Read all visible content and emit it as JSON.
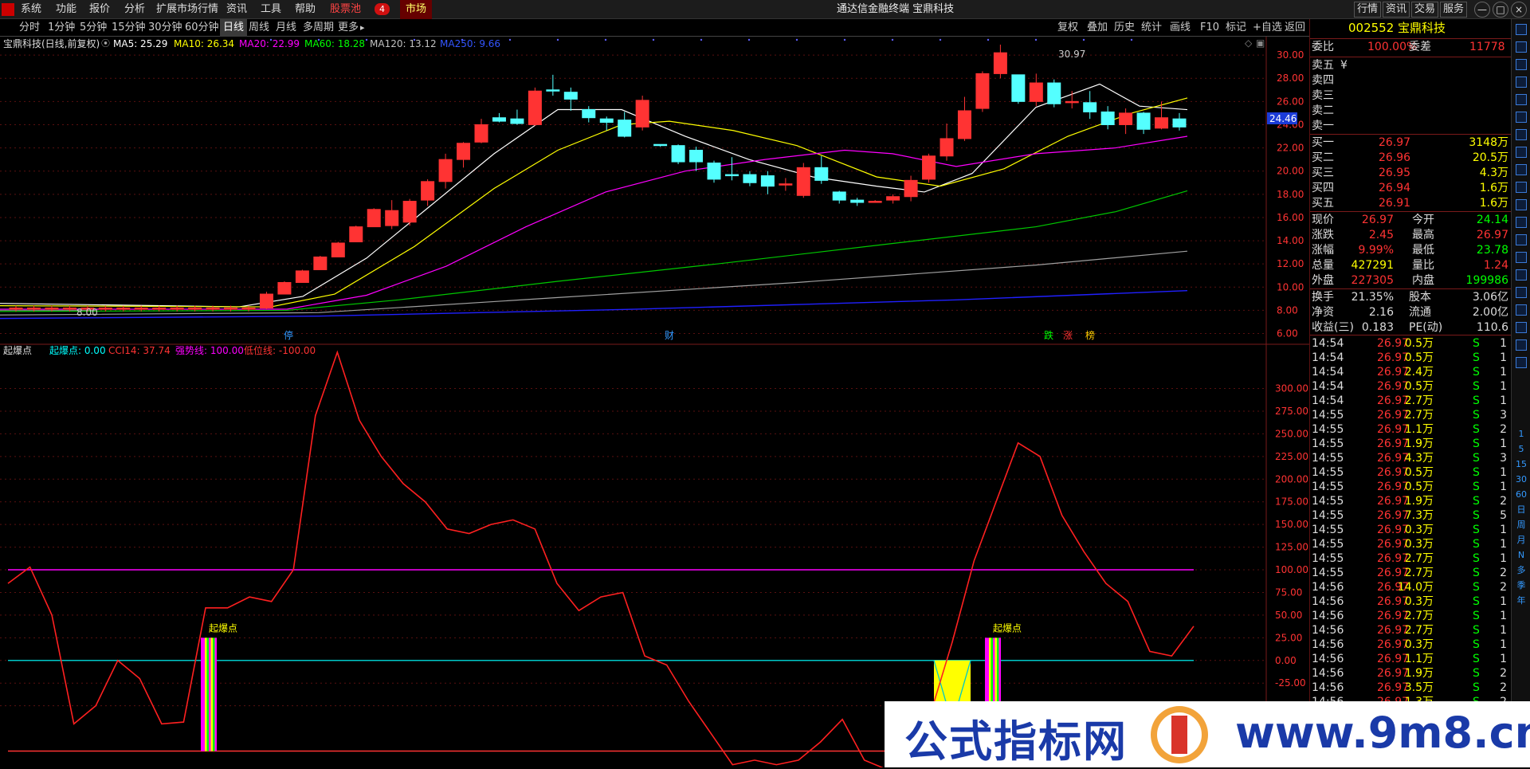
{
  "menubar": {
    "items": [
      "系统",
      "功能",
      "报价",
      "分析",
      "扩展市场行情",
      "资讯",
      "工具",
      "帮助",
      "股票池",
      "4",
      "市场"
    ],
    "window_title": "通达信金融终端  宝鼎科技"
  },
  "winbuttons": [
    "行情",
    "资讯",
    "交易",
    "服务",
    "—",
    "□",
    "×"
  ],
  "periods": [
    "分时",
    "1分钟",
    "5分钟",
    "15分钟",
    "30分钟",
    "60分钟",
    "日线",
    "周线",
    "月线",
    "多周期",
    "更多"
  ],
  "active_period": "日线",
  "toolbar": [
    "复权",
    "叠加",
    "历史",
    "统计",
    "画线",
    "F10",
    "标记",
    "+自选",
    "返回"
  ],
  "main_header": {
    "name": "宝鼎科技(日线,前复权)",
    "ma": [
      {
        "label": "MA5: 25.29",
        "color": "#ffffff"
      },
      {
        "label": "MA10: 26.34",
        "color": "#ffff00"
      },
      {
        "label": "MA20: 22.99",
        "color": "#ff00ff"
      },
      {
        "label": "MA60: 18.28",
        "color": "#00ff00"
      },
      {
        "label": "MA120: 13.12",
        "color": "#c0c0c0"
      },
      {
        "label": "MA250: 9.66",
        "color": "#0000ff"
      }
    ]
  },
  "high_label": "30.97",
  "low_label": "8.00",
  "price_tag": "24.46",
  "price_axis": [
    "30.00",
    "28.00",
    "26.00",
    "24.00",
    "22.00",
    "20.00",
    "18.00",
    "16.00",
    "14.00",
    "12.00",
    "10.00",
    "8.00",
    "6.00"
  ],
  "event_marks": [
    {
      "t": "停",
      "c": "#3399ff"
    },
    {
      "t": "财",
      "c": "#3399ff"
    },
    {
      "t": "跌",
      "c": "#00ff00"
    },
    {
      "t": "涨",
      "c": "#ff3333"
    },
    {
      "t": "榜",
      "c": "#ffcc00"
    }
  ],
  "indicator_header": {
    "name": "起爆点",
    "items": [
      {
        "label": "起爆点: 0.00",
        "color": "#00ffff"
      },
      {
        "label": "CCI14: 37.74",
        "color": "#ff3333"
      },
      {
        "label": "强势线: 100.00",
        "color": "#ff00ff"
      },
      {
        "label": "低位线: -100.00",
        "color": "#ff3333"
      }
    ]
  },
  "signal_label": "起爆点",
  "cci_axis": [
    "300.00",
    "275.00",
    "250.00",
    "225.00",
    "200.00",
    "175.00",
    "150.00",
    "125.00",
    "100.00",
    "75.00",
    "50.00",
    "25.00",
    "0.00",
    "-25.00",
    "-50.00"
  ],
  "chart_data": [
    {
      "type": "candlestick",
      "title": "宝鼎科技(日线,前复权)",
      "ylim": [
        6,
        31
      ],
      "candles": [
        [
          24.6,
          24.3,
          25.0,
          24.2
        ],
        [
          24.5,
          24.1,
          25.3,
          24.0
        ],
        [
          24.0,
          26.9,
          27.2,
          23.9
        ],
        [
          27.0,
          26.9,
          28.3,
          26.5
        ],
        [
          26.8,
          26.2,
          27.2,
          25.2
        ],
        [
          25.3,
          24.6,
          25.6,
          24.2
        ],
        [
          24.5,
          24.2,
          24.7,
          23.5
        ],
        [
          24.4,
          23.0,
          25.1,
          22.9
        ],
        [
          23.8,
          26.1,
          26.5,
          23.5
        ],
        [
          26.0,
          27.6,
          28.4,
          25.6
        ],
        [
          27.6,
          25.8,
          27.9,
          25.5
        ],
        [
          25.9,
          26.0,
          26.9,
          25.4
        ],
        [
          25.9,
          25.1,
          26.9,
          24.5
        ],
        [
          25.1,
          24.0,
          25.6,
          23.6
        ],
        [
          24.0,
          25.0,
          25.4,
          23.2
        ],
        [
          25.0,
          23.6,
          25.1,
          23.2
        ],
        [
          23.7,
          24.6,
          26.0,
          23.6
        ],
        [
          24.5,
          23.8,
          25.0,
          23.5
        ]
      ],
      "ma": [
        {
          "name": "MA5",
          "value": 25.29
        },
        {
          "name": "MA10",
          "value": 26.34
        },
        {
          "name": "MA20",
          "value": 22.99
        },
        {
          "name": "MA60",
          "value": 18.28
        },
        {
          "name": "MA120",
          "value": 13.12
        },
        {
          "name": "MA250",
          "value": 9.66
        }
      ]
    },
    {
      "type": "line",
      "title": "起爆点",
      "ylim": [
        -110,
        340
      ],
      "series": [
        {
          "name": "CCI14",
          "values": [
            85,
            103,
            50,
            -70,
            -50,
            0,
            -20,
            -70,
            -68,
            58,
            58,
            70,
            65,
            100,
            270,
            340,
            265,
            225,
            195,
            175,
            145,
            140,
            150,
            155,
            145,
            85,
            55,
            70,
            75,
            5,
            -5,
            -45,
            -80,
            -115,
            -110,
            -115,
            -110,
            -90,
            -65,
            -110,
            -120,
            -90,
            -60,
            20,
            110,
            175,
            240,
            225,
            160,
            120,
            85,
            65,
            10,
            5,
            37.74
          ]
        },
        {
          "name": "强势线",
          "values": [
            100
          ]
        },
        {
          "name": "低位线",
          "values": [
            -100
          ]
        },
        {
          "name": "起爆点",
          "values": [
            0
          ]
        }
      ]
    }
  ],
  "quote": {
    "code": "002552",
    "name": "宝鼎科技",
    "webi_label": "委比",
    "webi": "100.00%",
    "weicha_label": "委差",
    "weicha": "11778",
    "asks": [
      "卖五",
      "卖四",
      "卖三",
      "卖二",
      "卖一"
    ],
    "ask_price5": "¥",
    "bids": [
      {
        "l": "买一",
        "p": "26.97",
        "v": "3148万"
      },
      {
        "l": "买二",
        "p": "26.96",
        "v": "20.5万"
      },
      {
        "l": "买三",
        "p": "26.95",
        "v": "4.3万"
      },
      {
        "l": "买四",
        "p": "26.94",
        "v": "1.6万"
      },
      {
        "l": "买五",
        "p": "26.91",
        "v": "1.6万"
      }
    ],
    "stats": [
      {
        "l1": "现价",
        "v1": "26.97",
        "c1": "#ff3333",
        "l2": "今开",
        "v2": "24.14",
        "c2": "#00ff00"
      },
      {
        "l1": "涨跌",
        "v1": "2.45",
        "c1": "#ff3333",
        "l2": "最高",
        "v2": "26.97",
        "c2": "#ff3333"
      },
      {
        "l1": "涨幅",
        "v1": "9.99%",
        "c1": "#ff3333",
        "l2": "最低",
        "v2": "23.78",
        "c2": "#00ff00"
      },
      {
        "l1": "总量",
        "v1": "427291",
        "c1": "#ffff00",
        "l2": "量比",
        "v2": "1.24",
        "c2": "#ff3333"
      },
      {
        "l1": "外盘",
        "v1": "227305",
        "c1": "#ff3333",
        "l2": "内盘",
        "v2": "199986",
        "c2": "#00ff00"
      }
    ],
    "stats2": [
      {
        "l1": "换手",
        "v1": "21.35%",
        "l2": "股本",
        "v2": "3.06亿"
      },
      {
        "l1": "净资",
        "v1": "2.16",
        "l2": "流通",
        "v2": "2.00亿"
      },
      {
        "l1": "收益(三)",
        "v1": "0.183",
        "l2": "PE(动)",
        "v2": "110.6"
      }
    ],
    "ticks": [
      [
        "14:54",
        "26.97",
        "0.5万",
        "S",
        "1"
      ],
      [
        "14:54",
        "26.97",
        "0.5万",
        "S",
        "1"
      ],
      [
        "14:54",
        "26.97",
        "2.4万",
        "S",
        "1"
      ],
      [
        "14:54",
        "26.97",
        "0.5万",
        "S",
        "1"
      ],
      [
        "14:54",
        "26.97",
        "2.7万",
        "S",
        "1"
      ],
      [
        "14:55",
        "26.97",
        "2.7万",
        "S",
        "3"
      ],
      [
        "14:55",
        "26.97",
        "1.1万",
        "S",
        "2"
      ],
      [
        "14:55",
        "26.97",
        "1.9万",
        "S",
        "1"
      ],
      [
        "14:55",
        "26.97",
        "4.3万",
        "S",
        "3"
      ],
      [
        "14:55",
        "26.97",
        "0.5万",
        "S",
        "1"
      ],
      [
        "14:55",
        "26.97",
        "0.5万",
        "S",
        "1"
      ],
      [
        "14:55",
        "26.97",
        "1.9万",
        "S",
        "2"
      ],
      [
        "14:55",
        "26.97",
        "7.3万",
        "S",
        "5"
      ],
      [
        "14:55",
        "26.97",
        "0.3万",
        "S",
        "1"
      ],
      [
        "14:55",
        "26.97",
        "0.3万",
        "S",
        "1"
      ],
      [
        "14:55",
        "26.97",
        "2.7万",
        "S",
        "1"
      ],
      [
        "14:55",
        "26.97",
        "2.7万",
        "S",
        "2"
      ],
      [
        "14:56",
        "26.97",
        "14.0万",
        "S",
        "2"
      ],
      [
        "14:56",
        "26.97",
        "0.3万",
        "S",
        "1"
      ],
      [
        "14:56",
        "26.97",
        "2.7万",
        "S",
        "1"
      ],
      [
        "14:56",
        "26.97",
        "2.7万",
        "S",
        "1"
      ],
      [
        "14:56",
        "26.97",
        "0.3万",
        "S",
        "1"
      ],
      [
        "14:56",
        "26.97",
        "1.1万",
        "S",
        "1"
      ],
      [
        "14:56",
        "26.97",
        "1.9万",
        "S",
        "2"
      ],
      [
        "14:56",
        "26.97",
        "3.5万",
        "S",
        "2"
      ],
      [
        "14:56",
        "26.97",
        "1.3万",
        "S",
        "2"
      ]
    ]
  },
  "right_tools": [
    "1",
    "5",
    "15",
    "30",
    "60",
    "日",
    "周",
    "月",
    "N",
    "多",
    "季",
    "年"
  ],
  "watermark": {
    "left": "公式指标网",
    "right": "www.9m8.cn"
  }
}
